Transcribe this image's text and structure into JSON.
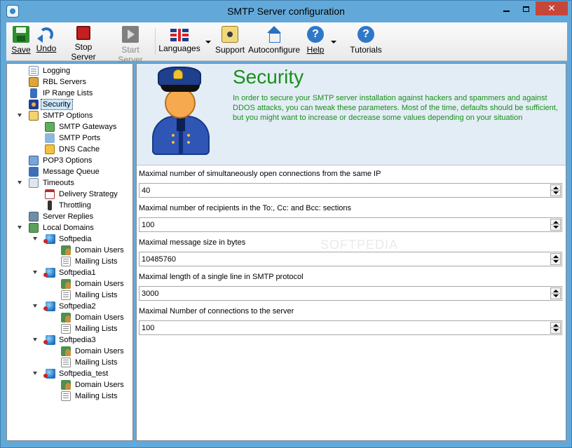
{
  "window": {
    "title": "SMTP Server configuration",
    "controls": {
      "minimize": "",
      "maximize": "",
      "close": "✕"
    }
  },
  "toolbar": {
    "buttons": [
      {
        "label": "Save",
        "icon": "save-icon",
        "enabled": true
      },
      {
        "label": "Undo",
        "icon": "undo-icon",
        "enabled": true
      },
      {
        "label": "Stop Server",
        "icon": "stop-icon",
        "enabled": true
      },
      {
        "label": "Start Server",
        "icon": "start-icon",
        "enabled": false
      },
      {
        "label": "Languages",
        "icon": "flag-icon",
        "enabled": true
      },
      {
        "label": "Support",
        "icon": "support-icon",
        "enabled": true
      },
      {
        "label": "Autoconfigure",
        "icon": "house-icon",
        "enabled": true
      },
      {
        "label": "Help",
        "icon": "help-icon",
        "enabled": true
      },
      {
        "label": "Tutorials",
        "icon": "help-icon",
        "enabled": true
      }
    ]
  },
  "tree": {
    "items": [
      {
        "label": "Logging",
        "icon": "log-icon"
      },
      {
        "label": "RBL Servers",
        "icon": "rbl-icon"
      },
      {
        "label": "IP Range Lists",
        "icon": "ip-icon"
      },
      {
        "label": "Security",
        "icon": "police-icon",
        "selected": true
      },
      {
        "label": "SMTP Options",
        "icon": "smtp-icon",
        "expanded": true
      },
      {
        "label": "SMTP Gateways",
        "icon": "gateway-icon"
      },
      {
        "label": "SMTP Ports",
        "icon": "ports-icon"
      },
      {
        "label": "DNS Cache",
        "icon": "dns-icon"
      },
      {
        "label": "POP3 Options",
        "icon": "pop3-icon"
      },
      {
        "label": "Message Queue",
        "icon": "queue-icon"
      },
      {
        "label": "Timeouts",
        "icon": "clock-icon",
        "expanded": true
      },
      {
        "label": "Delivery Strategy",
        "icon": "calendar-icon"
      },
      {
        "label": "Throttling",
        "icon": "traffic-light-icon"
      },
      {
        "label": "Server Replies",
        "icon": "servers-icon"
      },
      {
        "label": "Local Domains",
        "icon": "domains-icon",
        "expanded": true
      },
      {
        "label": "Softpedia",
        "icon": "globe-icon",
        "expanded": true
      },
      {
        "label": "Domain Users",
        "icon": "users-icon"
      },
      {
        "label": "Mailing Lists",
        "icon": "mailing-list-icon"
      },
      {
        "label": "Softpedia1",
        "icon": "globe-icon",
        "expanded": true
      },
      {
        "label": "Domain Users",
        "icon": "users-icon"
      },
      {
        "label": "Mailing Lists",
        "icon": "mailing-list-icon"
      },
      {
        "label": "Softpedia2",
        "icon": "globe-icon",
        "expanded": true
      },
      {
        "label": "Domain Users",
        "icon": "users-icon"
      },
      {
        "label": "Mailing Lists",
        "icon": "mailing-list-icon"
      },
      {
        "label": "Softpedia3",
        "icon": "globe-icon",
        "expanded": true
      },
      {
        "label": "Domain Users",
        "icon": "users-icon"
      },
      {
        "label": "Mailing Lists",
        "icon": "mailing-list-icon"
      },
      {
        "label": "Softpedia_test",
        "icon": "globe-icon",
        "expanded": true
      },
      {
        "label": "Domain Users",
        "icon": "users-icon"
      },
      {
        "label": "Mailing Lists",
        "icon": "mailing-list-icon"
      }
    ]
  },
  "header": {
    "title": "Security",
    "description": "In order to secure your SMTP server installation against hackers and spammers and against DDOS attacks, you can tweak these parameters. Most of the time, defaults should be sufficient, but you might want to increase or decrease some values depending on your situation",
    "title_color": "#1a8f1a"
  },
  "watermark": "SOFTPEDIA",
  "fields": [
    {
      "label": "Maximal number of simultaneously open connections from the same IP",
      "value": "40"
    },
    {
      "label": "Maximal number of recipients in the To:, Cc: and Bcc: sections",
      "value": "100"
    },
    {
      "label": "Maximal message size in bytes",
      "value": "10485760"
    },
    {
      "label": "Maximal length of a single line in SMTP protocol",
      "value": "3000"
    },
    {
      "label": "Maximal Number of connections to the server",
      "value": "100"
    }
  ]
}
